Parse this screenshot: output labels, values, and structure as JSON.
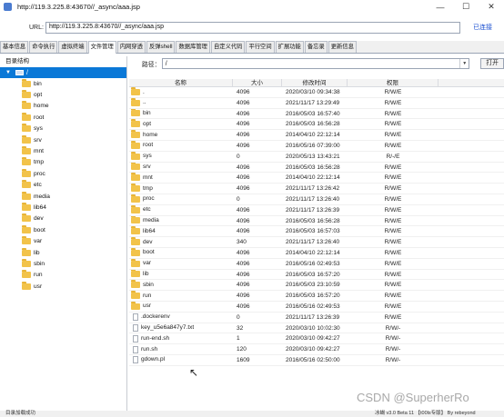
{
  "window": {
    "title": "http://119.3.225.8:43670//_async/aaa.jsp",
    "controls": [
      "—",
      "☐",
      "✕"
    ]
  },
  "urlbar": {
    "label": "URL:",
    "value": "http://119.3.225.8:43670//_async/aaa.jsp",
    "status": "已连接"
  },
  "tabs": [
    "基本信息",
    "命令执行",
    "虚拟终端",
    "文件管理",
    "内网穿透",
    "反弹shell",
    "数据库管理",
    "自定义代码",
    "平行空间",
    "扩展功能",
    "备忘录",
    "更新信息"
  ],
  "active_tab": "文件管理",
  "tree": {
    "header": "目录结构",
    "root": "/",
    "folders": [
      "bin",
      "opt",
      "home",
      "root",
      "sys",
      "srv",
      "mnt",
      "tmp",
      "proc",
      "etc",
      "media",
      "lib64",
      "dev",
      "boot",
      "var",
      "lib",
      "sbin",
      "run",
      "usr"
    ]
  },
  "path": {
    "label": "路径：",
    "value": "/",
    "open_button": "打开"
  },
  "table": {
    "columns": [
      "名称",
      "大小",
      "修改时间",
      "权限"
    ],
    "rows": [
      {
        "name": ".",
        "size": "4096",
        "time": "2020/03/10 09:34:38",
        "perm": "R/W/E",
        "type": "folder"
      },
      {
        "name": "..",
        "size": "4096",
        "time": "2021/11/17 13:29:49",
        "perm": "R/W/E",
        "type": "folder"
      },
      {
        "name": "bin",
        "size": "4096",
        "time": "2016/05/03 16:57:40",
        "perm": "R/W/E",
        "type": "folder"
      },
      {
        "name": "opt",
        "size": "4096",
        "time": "2016/05/03 16:56:28",
        "perm": "R/W/E",
        "type": "folder"
      },
      {
        "name": "home",
        "size": "4096",
        "time": "2014/04/10 22:12:14",
        "perm": "R/W/E",
        "type": "folder"
      },
      {
        "name": "root",
        "size": "4096",
        "time": "2016/05/16 07:39:00",
        "perm": "R/W/E",
        "type": "folder"
      },
      {
        "name": "sys",
        "size": "0",
        "time": "2020/05/13 13:43:21",
        "perm": "R/-/E",
        "type": "folder"
      },
      {
        "name": "srv",
        "size": "4096",
        "time": "2016/05/03 16:56:28",
        "perm": "R/W/E",
        "type": "folder"
      },
      {
        "name": "mnt",
        "size": "4096",
        "time": "2014/04/10 22:12:14",
        "perm": "R/W/E",
        "type": "folder"
      },
      {
        "name": "tmp",
        "size": "4096",
        "time": "2021/11/17 13:26:42",
        "perm": "R/W/E",
        "type": "folder"
      },
      {
        "name": "proc",
        "size": "0",
        "time": "2021/11/17 13:26:40",
        "perm": "R/W/E",
        "type": "folder"
      },
      {
        "name": "etc",
        "size": "4096",
        "time": "2021/11/17 13:26:39",
        "perm": "R/W/E",
        "type": "folder"
      },
      {
        "name": "media",
        "size": "4096",
        "time": "2016/05/03 16:56:28",
        "perm": "R/W/E",
        "type": "folder"
      },
      {
        "name": "lib64",
        "size": "4096",
        "time": "2016/05/03 16:57:03",
        "perm": "R/W/E",
        "type": "folder"
      },
      {
        "name": "dev",
        "size": "340",
        "time": "2021/11/17 13:26:40",
        "perm": "R/W/E",
        "type": "folder"
      },
      {
        "name": "boot",
        "size": "4096",
        "time": "2014/04/10 22:12:14",
        "perm": "R/W/E",
        "type": "folder"
      },
      {
        "name": "var",
        "size": "4096",
        "time": "2016/05/16 02:49:53",
        "perm": "R/W/E",
        "type": "folder"
      },
      {
        "name": "lib",
        "size": "4096",
        "time": "2016/05/03 16:57:20",
        "perm": "R/W/E",
        "type": "folder"
      },
      {
        "name": "sbin",
        "size": "4096",
        "time": "2016/05/03 23:10:59",
        "perm": "R/W/E",
        "type": "folder"
      },
      {
        "name": "run",
        "size": "4096",
        "time": "2016/05/03 16:57:20",
        "perm": "R/W/E",
        "type": "folder"
      },
      {
        "name": "usr",
        "size": "4096",
        "time": "2016/05/16 02:49:53",
        "perm": "R/W/E",
        "type": "folder"
      },
      {
        "name": ".dockerenv",
        "size": "0",
        "time": "2021/11/17 13:26:39",
        "perm": "R/W/E",
        "type": "file"
      },
      {
        "name": "key_u5e6a847y7.txt",
        "size": "32",
        "time": "2020/03/10 10:02:30",
        "perm": "R/W/-",
        "type": "file"
      },
      {
        "name": "run-end.sh",
        "size": "1",
        "time": "2020/03/10 09:42:27",
        "perm": "R/W/-",
        "type": "file"
      },
      {
        "name": "run.sh",
        "size": "120",
        "time": "2020/03/10 09:42:27",
        "perm": "R/W/-",
        "type": "file"
      },
      {
        "name": "gdown.pl",
        "size": "1609",
        "time": "2016/05/16 02:50:00",
        "perm": "R/W/-",
        "type": "file"
      }
    ]
  },
  "status": {
    "left": "目录加载成功",
    "right": "冰蝎 v3.0 Beta 11 【t00ls专版】   By rebeyond"
  },
  "watermark": "CSDN @SuperherRo",
  "colors": {
    "selection": "#0a78d7",
    "folder": "#f2c34a",
    "link": "#1a4fd0"
  }
}
